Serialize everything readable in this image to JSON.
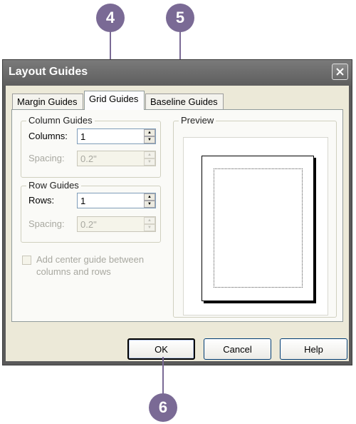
{
  "callouts": [
    "4",
    "5",
    "6"
  ],
  "dialog": {
    "title": "Layout Guides",
    "close_icon": "close-x-icon"
  },
  "tabs": [
    {
      "label": "Margin Guides",
      "active": false
    },
    {
      "label": "Grid Guides",
      "active": true
    },
    {
      "label": "Baseline Guides",
      "active": false
    }
  ],
  "column_guides": {
    "title": "Column Guides",
    "columns_label": "Columns:",
    "columns_value": "1",
    "spacing_label": "Spacing:",
    "spacing_value": "0.2\""
  },
  "row_guides": {
    "title": "Row Guides",
    "rows_label": "Rows:",
    "rows_value": "1",
    "spacing_label": "Spacing:",
    "spacing_value": "0.2\""
  },
  "center_guide": {
    "label_line1": "Add center guide between",
    "label_line2": "columns and rows",
    "checked": false
  },
  "preview": {
    "title": "Preview"
  },
  "buttons": {
    "ok": "OK",
    "cancel": "Cancel",
    "help": "Help"
  },
  "colors": {
    "callout": "#7a6a95",
    "dialog_face": "#ece9d8",
    "titlebar": "#6a6a6a"
  }
}
